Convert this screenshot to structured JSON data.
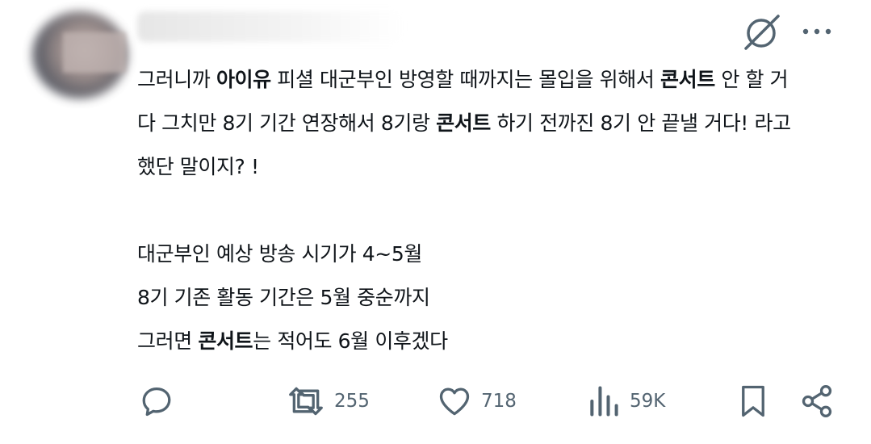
{
  "tweet": {
    "paragraphs": [
      {
        "lines": [
          [
            {
              "t": "그러니까 ",
              "b": false
            },
            {
              "t": "아이유",
              "b": true
            },
            {
              "t": " 피셜 대군부인 방영할 때까지는 몰입을 위해서 ",
              "b": false
            },
            {
              "t": "콘서트",
              "b": true
            },
            {
              "t": " 안 할 거",
              "b": false
            }
          ],
          [
            {
              "t": "다 그치만 8기 기간 연장해서 8기랑 ",
              "b": false
            },
            {
              "t": "콘서트",
              "b": true
            },
            {
              "t": " 하기 전까진 8기 안 끝낼 거다!  라고",
              "b": false
            }
          ],
          [
            {
              "t": "했단 말이지? !",
              "b": false
            }
          ]
        ]
      },
      {
        "lines": [
          [
            {
              "t": "대군부인 예상 방송 시기가 4~5월",
              "b": false
            }
          ],
          [
            {
              "t": "8기 기존 활동 기간은 5월 중순까지",
              "b": false
            }
          ],
          [
            {
              "t": "그러면 ",
              "b": false
            },
            {
              "t": "콘서트",
              "b": true
            },
            {
              "t": "는 적어도 6월 이후겠다",
              "b": false
            }
          ]
        ]
      }
    ]
  },
  "actions": {
    "reply": {
      "icon": "reply-icon"
    },
    "retweet": {
      "icon": "retweet-icon",
      "count": "255"
    },
    "like": {
      "icon": "heart-icon",
      "count": "718"
    },
    "views": {
      "icon": "views-icon",
      "count": "59K"
    },
    "bookmark": {
      "icon": "bookmark-icon"
    },
    "share": {
      "icon": "share-icon"
    }
  },
  "colors": {
    "text": "#0f1419",
    "secondary": "#536471"
  }
}
